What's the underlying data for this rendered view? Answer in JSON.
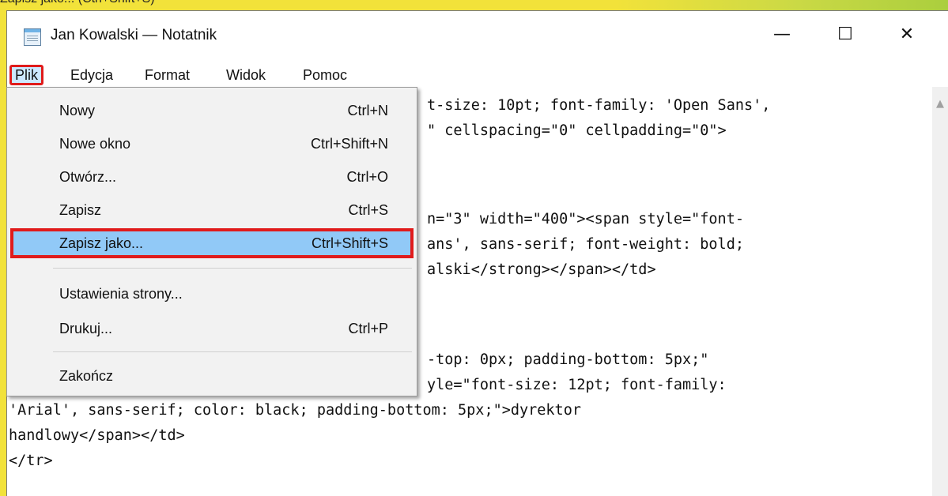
{
  "top_caption": "Zapisz jako... (Ctrl+Shift+S)",
  "window": {
    "title": "Jan Kowalski — Notatnik",
    "controls": {
      "minimize": "—",
      "maximize": "☐",
      "close": "✕"
    }
  },
  "menubar": {
    "items": [
      "Plik",
      "Edycja",
      "Format",
      "Widok",
      "Pomoc"
    ],
    "active": "Plik"
  },
  "file_menu": {
    "items": [
      {
        "label": "Nowy",
        "shortcut": "Ctrl+N"
      },
      {
        "label": "Nowe okno",
        "shortcut": "Ctrl+Shift+N"
      },
      {
        "label": "Otwórz...",
        "shortcut": "Ctrl+O"
      },
      {
        "label": "Zapisz",
        "shortcut": "Ctrl+S"
      },
      {
        "label": "Zapisz jako...",
        "shortcut": "Ctrl+Shift+S"
      },
      {
        "label": "Ustawienia strony...",
        "shortcut": ""
      },
      {
        "label": "Drukuj...",
        "shortcut": "Ctrl+P"
      },
      {
        "label": "Zakończ",
        "shortcut": ""
      }
    ],
    "selected": "Zapisz jako..."
  },
  "editor": {
    "lines": [
      "t-size: 10pt; font-family: 'Open Sans',",
      "\" cellspacing=\"0\" cellpadding=\"0\">",
      "",
      "",
      "n=\"3\" width=\"400\"><span style=\"font-",
      "ans', sans-serif; font-weight: bold;",
      "alski</strong></span></td>",
      "",
      "",
      "-top: 0px; padding-bottom: 5px;\"",
      "yle=\"font-size: 12pt; font-family:",
      "'Arial', sans-serif; color: black; padding-bottom: 5px;\">dyrektor",
      "handlowy</span></td>",
      "</tr>"
    ]
  },
  "colors": {
    "highlight_border": "#e01b1b",
    "menu_selection": "#91c9f7",
    "active_menu_bg": "#cce8ff",
    "background": "#f2e23a"
  }
}
